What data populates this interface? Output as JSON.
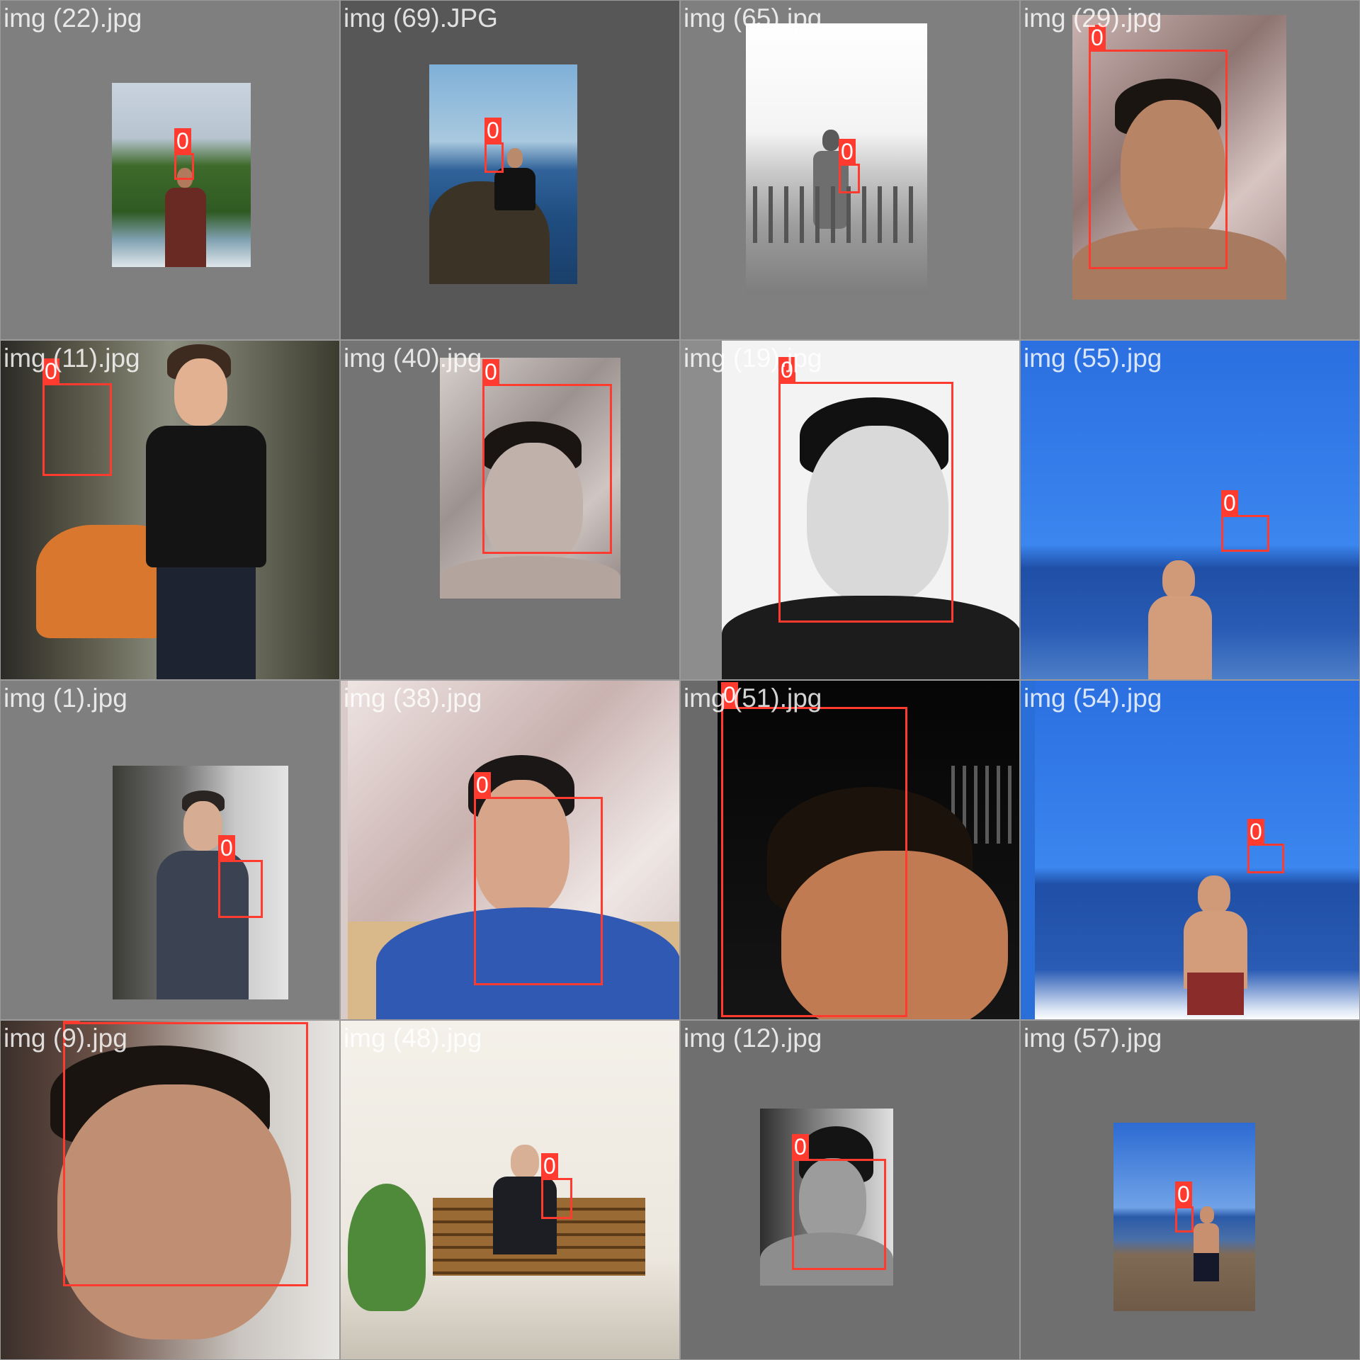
{
  "colors": {
    "box": "#ff3b30",
    "label_bg": "#ff3b30",
    "label_text": "#ffffff",
    "filename_text": "#ffffff"
  },
  "tiles": [
    {
      "filename": "img (22).jpg",
      "label": "0"
    },
    {
      "filename": "img (69).JPG",
      "label": "0"
    },
    {
      "filename": "img (65).jpg",
      "label": "0"
    },
    {
      "filename": "img (29).jpg",
      "label": "0"
    },
    {
      "filename": "img (11).jpg",
      "label": "0"
    },
    {
      "filename": "img (40).jpg",
      "label": "0"
    },
    {
      "filename": "img (19).jpg",
      "label": "0"
    },
    {
      "filename": "img (55).jpg",
      "label": "0"
    },
    {
      "filename": "img (1).jpg",
      "label": "0"
    },
    {
      "filename": "img (38).jpg",
      "label": "0"
    },
    {
      "filename": "img (51).jpg",
      "label": "0"
    },
    {
      "filename": "img (54).jpg",
      "label": "0"
    },
    {
      "filename": "img (9).jpg",
      "label": "0"
    },
    {
      "filename": "img (48).jpg",
      "label": "0"
    },
    {
      "filename": "img (12).jpg",
      "label": "0"
    },
    {
      "filename": "img (57).jpg",
      "label": "0"
    }
  ]
}
